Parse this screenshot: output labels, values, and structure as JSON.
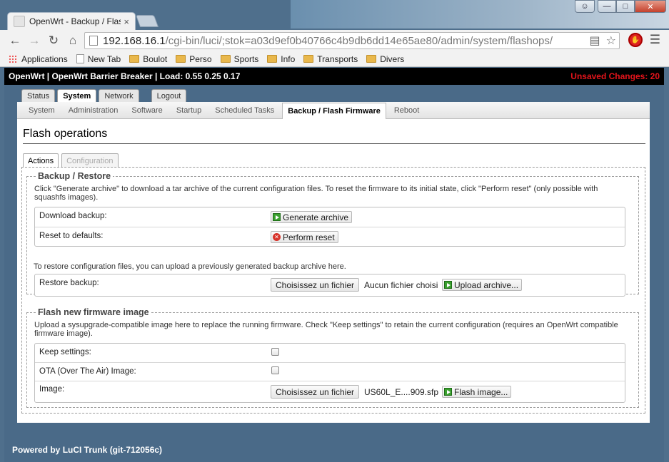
{
  "browser": {
    "tab_title": "OpenWrt - Backup / Flash",
    "tab_close": "×",
    "url_host": "192.168.16.1",
    "url_path": "/cgi-bin/luci/;stok=a03d9ef0b40766c4b9db6dd14e65ae80/admin/system/flashops/",
    "bookmarks": [
      "Applications",
      "New Tab",
      "Boulot",
      "Perso",
      "Sports",
      "Info",
      "Transports",
      "Divers"
    ]
  },
  "header": {
    "title": "OpenWrt | OpenWrt Barrier Breaker | Load: 0.55 0.25 0.17",
    "unsaved": "Unsaved Changes: 20"
  },
  "main_tabs": [
    "Status",
    "System",
    "Network",
    "Logout"
  ],
  "sub_tabs": [
    "System",
    "Administration",
    "Software",
    "Startup",
    "Scheduled Tasks",
    "Backup / Flash Firmware",
    "Reboot"
  ],
  "page_title": "Flash operations",
  "content_tabs": [
    "Actions",
    "Configuration"
  ],
  "backup": {
    "legend": "Backup / Restore",
    "description": "Click \"Generate archive\" to download a tar archive of the current configuration files. To reset the firmware to its initial state, click \"Perform reset\" (only possible with squashfs images).",
    "download_label": "Download backup:",
    "generate_btn": "Generate archive",
    "reset_label": "Reset to defaults:",
    "reset_btn": "Perform reset",
    "restore_desc": "To restore configuration files, you can upload a previously generated backup archive here.",
    "restore_label": "Restore backup:",
    "choose_file_btn": "Choisissez un fichier",
    "no_file": "Aucun fichier choisi",
    "upload_btn": "Upload archive..."
  },
  "flash": {
    "legend": "Flash new firmware image",
    "description": "Upload a sysupgrade-compatible image here to replace the running firmware. Check \"Keep settings\" to retain the current configuration (requires an OpenWrt compatible firmware image).",
    "keep_label": "Keep settings:",
    "ota_label": "OTA (Over The Air) Image:",
    "image_label": "Image:",
    "choose_file_btn": "Choisissez un fichier",
    "file_name": "US60L_E....909.sfp",
    "flash_btn": "Flash image..."
  },
  "footer": "Powered by LuCI Trunk (git-712056c)"
}
